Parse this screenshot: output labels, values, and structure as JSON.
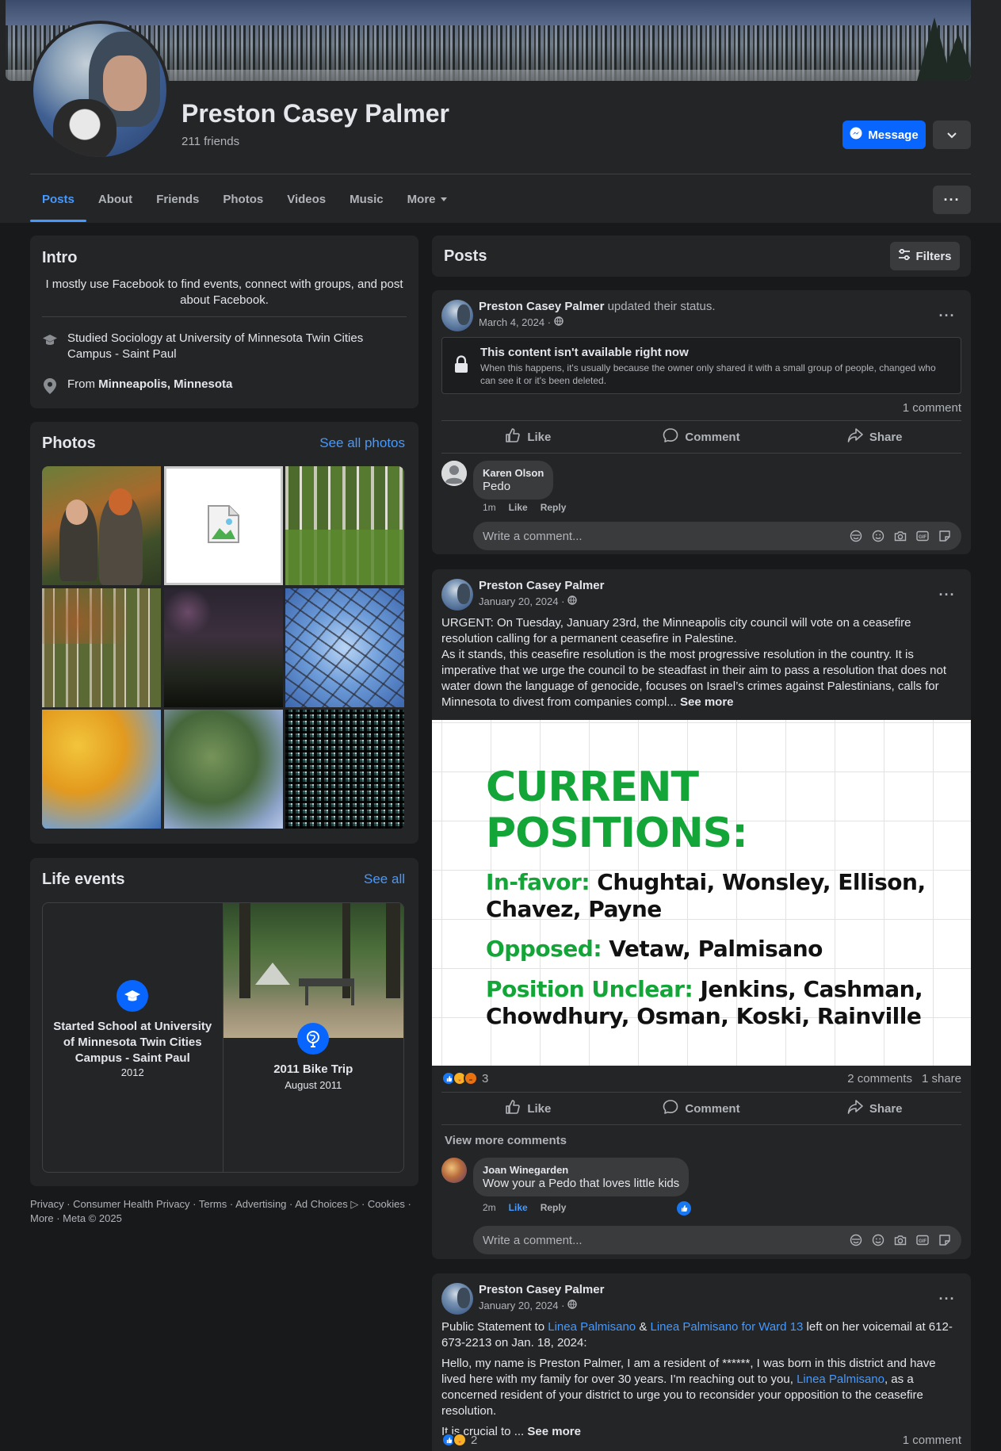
{
  "profile": {
    "name": "Preston Casey Palmer",
    "friends": "211 friends",
    "message_button": "Message"
  },
  "tabs": [
    {
      "label": "Posts",
      "active": true
    },
    {
      "label": "About"
    },
    {
      "label": "Friends"
    },
    {
      "label": "Photos"
    },
    {
      "label": "Videos"
    },
    {
      "label": "Music"
    },
    {
      "label": "More"
    }
  ],
  "intro": {
    "title": "Intro",
    "bio": "I mostly use Facebook to find events, connect with groups, and post about Facebook.",
    "education": "Studied Sociology at University of Minnesota Twin Cities Campus - Saint Paul",
    "from_prefix": "From",
    "from_place": "Minneapolis, Minnesota"
  },
  "photos": {
    "title": "Photos",
    "see_all": "See all photos"
  },
  "life_events": {
    "title": "Life events",
    "see_all": "See all",
    "items": [
      {
        "title": "Started School at University of Minnesota Twin Cities Campus - Saint Paul",
        "date": "2012",
        "icon": "graduation-cap-icon"
      },
      {
        "title": "2011 Bike Trip",
        "date": "August 2011",
        "icon": "globe-pin-icon"
      }
    ]
  },
  "footer": "Privacy · Consumer Health Privacy · Terms · Advertising · Ad Choices ▷ · Cookies · More · Meta © 2025",
  "posts_header": {
    "title": "Posts",
    "filters": "Filters"
  },
  "actions": {
    "like": "Like",
    "comment": "Comment",
    "share": "Share"
  },
  "comment_placeholder": "Write a comment...",
  "posts": [
    {
      "author": "Preston Casey Palmer",
      "action": "updated their status.",
      "date": "March 4, 2024 ·",
      "unavailable_title": "This content isn't available right now",
      "unavailable_text": "When this happens, it's usually because the owner only shared it with a small group of people, changed who can see it or it's been deleted.",
      "comment_count": "1 comment",
      "comments": [
        {
          "name": "Karen Olson",
          "text": "Pedo",
          "time": "1m",
          "like": "Like",
          "reply": "Reply"
        }
      ]
    },
    {
      "author": "Preston Casey Palmer",
      "date": "January 20, 2024 ·",
      "text_p1": "URGENT: On Tuesday, January 23rd, the Minneapolis city council will vote on a ceasefire resolution calling for a permanent ceasefire in Palestine.",
      "text_p2": "As it stands, this ceasefire resolution is the most progressive resolution in the country. It is imperative that we urge the council to be steadfast in their aim to pass a resolution that does not water down the language of genocide, focuses on Israel’s crimes against Palestinians, calls for Minnesota to divest from companies compl...",
      "see_more": "See more",
      "image": {
        "heading_1": "CURRENT",
        "heading_2": "POSITIONS:",
        "in_favor_label": "In-favor:",
        "in_favor_1": "Chughtai, Wonsley, Ellison,",
        "in_favor_2": "Chavez, Payne",
        "opposed_label": "Opposed:",
        "opposed": "Vetaw, Palmisano",
        "unclear_label": "Position Unclear:",
        "unclear_1": "Jenkins, Cashman,",
        "unclear_2": "Chowdhury, Osman, Koski, Rainville"
      },
      "reaction_count": "3",
      "comment_count": "2 comments",
      "share_count": "1 share",
      "view_more": "View more comments",
      "comments": [
        {
          "name": "Joan Winegarden",
          "text": "Wow your a Pedo that loves little kids",
          "time": "2m",
          "like": "Like",
          "reply": "Reply"
        }
      ]
    },
    {
      "author": "Preston Casey Palmer",
      "date": "January 20, 2024 ·",
      "intro_a": "Public Statement to ",
      "link_1": "Linea Palmisano",
      "amp": " & ",
      "link_2": "Linea Palmisano for Ward 13",
      "intro_b": " left on her voicemail at 612-673-2213 on Jan. 18, 2024:",
      "body_a": "Hello, my name is Preston Palmer, I am a resident of ******, I was born in this district and have lived here with my family for over 30 years. I'm reaching out to you, ",
      "body_link": "Linea Palmisano",
      "body_b": ", as a concerned resident of your district to urge you to reconsider your opposition to the ceasefire resolution.",
      "crucial": "It is crucial to ... ",
      "see_more": "See more",
      "reaction_count": "2",
      "comment_count": "1 comment"
    }
  ]
}
